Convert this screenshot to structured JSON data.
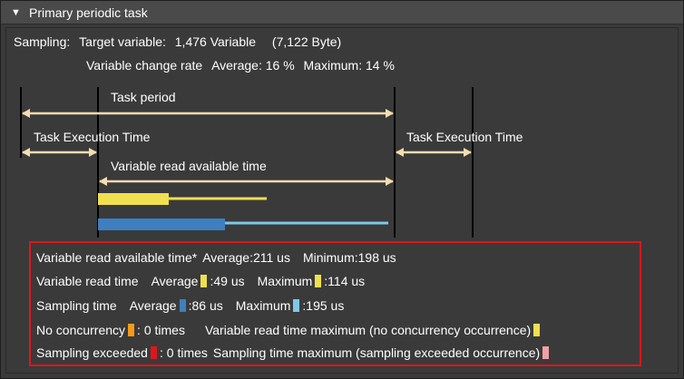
{
  "header": {
    "title": "Primary periodic task",
    "toggle_icon": "triangle-down"
  },
  "sampling": {
    "label": "Sampling:",
    "target_label": "Target variable:",
    "target_count": "1,476",
    "variable_word": "Variable",
    "byte_size": "(7,122 Byte)",
    "change_rate_label": "Variable change rate",
    "average_label": "Average:",
    "average_value": "16 %",
    "maximum_label": "Maximum:",
    "maximum_value": "14 %"
  },
  "diagram": {
    "task_period": "Task period",
    "task_exec_left": "Task Execution Time",
    "task_exec_right": "Task Execution Time",
    "read_available": "Variable read available time"
  },
  "colors": {
    "background": "#3a3a3a",
    "arrow": "#f5ddb0",
    "read_bar": "#f0e050",
    "sampling_bar": "#3e7fc0",
    "sampling_line": "#7ec8e8",
    "no_concurrency": "#f59a1b",
    "exceeded": "#e0151c",
    "exceeded_max": "#f0a0a8",
    "box_border": "#e0151c"
  },
  "stats": {
    "read_available_label": "Variable read available time*",
    "read_available_avg_label": "Average:",
    "read_available_avg": "211 us",
    "read_available_min_label": "Minimum:",
    "read_available_min": "198 us",
    "read_time_label": "Variable read time",
    "read_time_avg_label": "Average",
    "read_time_avg": ":49 us",
    "read_time_max_label": "Maximum",
    "read_time_max": ":114 us",
    "sampling_time_label": "Sampling time",
    "sampling_time_avg_label": "Average",
    "sampling_time_avg": ":86 us",
    "sampling_time_max_label": "Maximum",
    "sampling_time_max": ":195 us",
    "no_concurrency_label": "No concurrency",
    "no_concurrency_value": ": 0 times",
    "read_time_max_nc_label": "Variable read time maximum (no concurrency occurrence)",
    "sampling_exceeded_label": "Sampling exceeded",
    "sampling_exceeded_value": ": 0 times",
    "sampling_time_max_se_label": "Sampling time maximum (sampling exceeded occurrence)"
  }
}
